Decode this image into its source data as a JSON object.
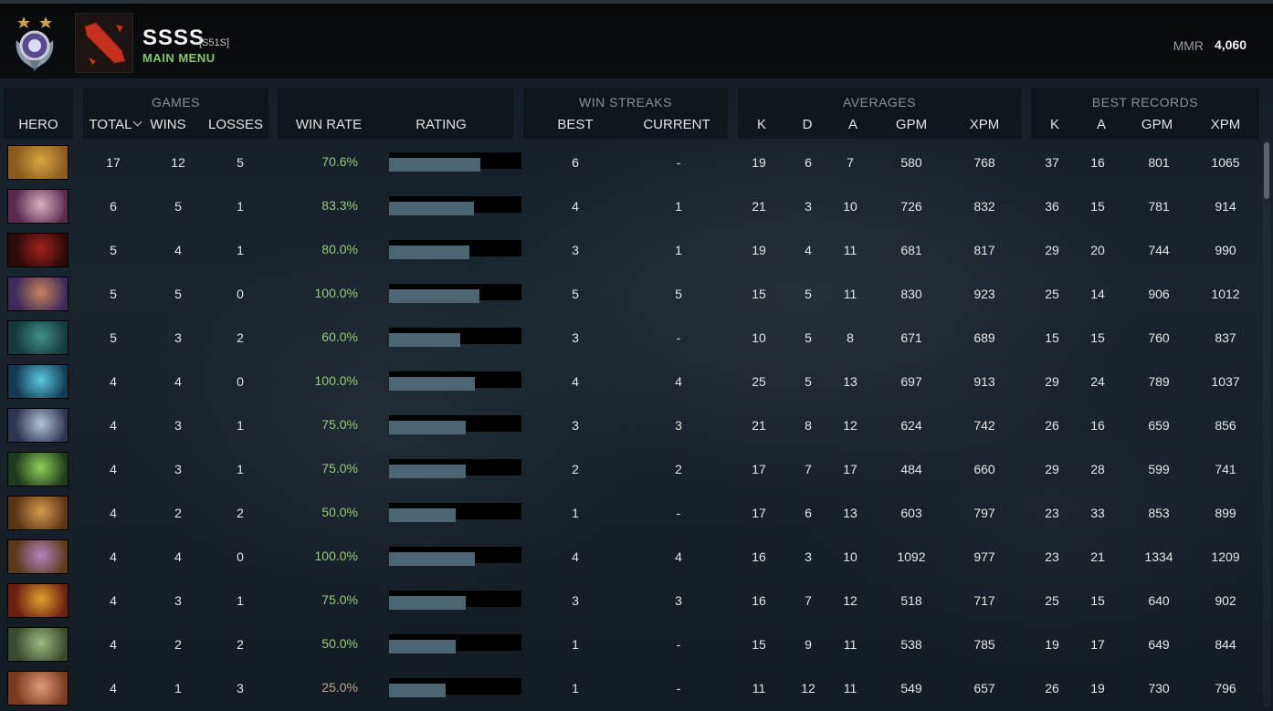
{
  "header": {
    "player_name": "SSSS",
    "player_tag": "[S51S]",
    "menu_label": "MAIN MENU",
    "mmr_label": "MMR",
    "mmr_value": "4,060"
  },
  "groups": {
    "games": "GAMES",
    "win_streaks": "WIN STREAKS",
    "averages": "AVERAGES",
    "best_records": "BEST RECORDS"
  },
  "columns": {
    "hero": "HERO",
    "total": "TOTAL",
    "wins": "WINS",
    "losses": "LOSSES",
    "win_rate": "WIN RATE",
    "rating": "RATING",
    "best": "BEST",
    "current": "CURRENT",
    "avg_k": "K",
    "avg_d": "D",
    "avg_a": "A",
    "avg_gpm": "GPM",
    "avg_xpm": "XPM",
    "best_k": "K",
    "best_a": "A",
    "best_gpm": "GPM",
    "best_xpm": "XPM"
  },
  "rows": [
    {
      "hero_icon": "monkey-king-portrait",
      "c1": "#8a5a1e",
      "c2": "#d8a440",
      "total": "17",
      "wins": "12",
      "losses": "5",
      "win_rate": "70.6%",
      "rating": 0.69,
      "best": "6",
      "current": "-",
      "k": "19",
      "d": "6",
      "a": "7",
      "gpm": "580",
      "xpm": "768",
      "bk": "37",
      "ba": "16",
      "bgpm": "801",
      "bxpm": "1065"
    },
    {
      "hero_icon": "invoker-portrait",
      "c1": "#5b2a4e",
      "c2": "#d9b1c0",
      "total": "6",
      "wins": "5",
      "losses": "1",
      "win_rate": "83.3%",
      "rating": 0.64,
      "best": "4",
      "current": "1",
      "k": "21",
      "d": "3",
      "a": "10",
      "gpm": "726",
      "xpm": "832",
      "bk": "36",
      "ba": "15",
      "bgpm": "781",
      "bxpm": "914"
    },
    {
      "hero_icon": "shadow-fiend-portrait",
      "c1": "#2a0a0a",
      "c2": "#a3221e",
      "total": "5",
      "wins": "4",
      "losses": "1",
      "win_rate": "80.0%",
      "rating": 0.61,
      "best": "3",
      "current": "1",
      "k": "19",
      "d": "4",
      "a": "11",
      "gpm": "681",
      "xpm": "817",
      "bk": "29",
      "ba": "20",
      "bgpm": "744",
      "bxpm": "990"
    },
    {
      "hero_icon": "anti-mage-portrait",
      "c1": "#3b2a5a",
      "c2": "#c8845a",
      "total": "5",
      "wins": "5",
      "losses": "0",
      "win_rate": "100.0%",
      "rating": 0.68,
      "best": "5",
      "current": "5",
      "k": "15",
      "d": "5",
      "a": "11",
      "gpm": "830",
      "xpm": "923",
      "bk": "25",
      "ba": "14",
      "bgpm": "906",
      "bxpm": "1012"
    },
    {
      "hero_icon": "templar-assassin-portrait",
      "c1": "#143a3a",
      "c2": "#3f8e88",
      "total": "5",
      "wins": "3",
      "losses": "2",
      "win_rate": "60.0%",
      "rating": 0.54,
      "best": "3",
      "current": "-",
      "k": "10",
      "d": "5",
      "a": "8",
      "gpm": "671",
      "xpm": "689",
      "bk": "15",
      "ba": "15",
      "bgpm": "760",
      "bxpm": "837"
    },
    {
      "hero_icon": "morphling-portrait",
      "c1": "#123a52",
      "c2": "#58c9de",
      "total": "4",
      "wins": "4",
      "losses": "0",
      "win_rate": "100.0%",
      "rating": 0.65,
      "best": "4",
      "current": "4",
      "k": "25",
      "d": "5",
      "a": "13",
      "gpm": "697",
      "xpm": "913",
      "bk": "29",
      "ba": "24",
      "bgpm": "789",
      "bxpm": "1037"
    },
    {
      "hero_icon": "mirana-portrait",
      "c1": "#2e3550",
      "c2": "#b7c2d8",
      "total": "4",
      "wins": "3",
      "losses": "1",
      "win_rate": "75.0%",
      "rating": 0.58,
      "best": "3",
      "current": "3",
      "k": "21",
      "d": "8",
      "a": "12",
      "gpm": "624",
      "xpm": "742",
      "bk": "26",
      "ba": "16",
      "bgpm": "659",
      "bxpm": "856"
    },
    {
      "hero_icon": "juggernaut-portrait",
      "c1": "#1e3a1c",
      "c2": "#8fd05a",
      "total": "4",
      "wins": "3",
      "losses": "1",
      "win_rate": "75.0%",
      "rating": 0.58,
      "best": "2",
      "current": "2",
      "k": "17",
      "d": "7",
      "a": "17",
      "gpm": "484",
      "xpm": "660",
      "bk": "29",
      "ba": "28",
      "bgpm": "599",
      "bxpm": "741"
    },
    {
      "hero_icon": "troll-warlord-portrait",
      "c1": "#5a3515",
      "c2": "#d59a4e",
      "total": "4",
      "wins": "2",
      "losses": "2",
      "win_rate": "50.0%",
      "rating": 0.5,
      "best": "1",
      "current": "-",
      "k": "17",
      "d": "6",
      "a": "13",
      "gpm": "603",
      "xpm": "797",
      "bk": "23",
      "ba": "33",
      "bgpm": "853",
      "bxpm": "899"
    },
    {
      "hero_icon": "alchemist-portrait",
      "c1": "#5a3a1a",
      "c2": "#b582c0",
      "total": "4",
      "wins": "4",
      "losses": "0",
      "win_rate": "100.0%",
      "rating": 0.65,
      "best": "4",
      "current": "4",
      "k": "16",
      "d": "3",
      "a": "10",
      "gpm": "1092",
      "xpm": "977",
      "bk": "23",
      "ba": "21",
      "bgpm": "1334",
      "bxpm": "1209"
    },
    {
      "hero_icon": "ember-spirit-portrait",
      "c1": "#6a2010",
      "c2": "#e0a030",
      "total": "4",
      "wins": "3",
      "losses": "1",
      "win_rate": "75.0%",
      "rating": 0.58,
      "best": "3",
      "current": "3",
      "k": "16",
      "d": "7",
      "a": "12",
      "gpm": "518",
      "xpm": "717",
      "bk": "25",
      "ba": "15",
      "bgpm": "640",
      "bxpm": "902"
    },
    {
      "hero_icon": "tiny-portrait",
      "c1": "#3a4a2e",
      "c2": "#9fb880",
      "total": "4",
      "wins": "2",
      "losses": "2",
      "win_rate": "50.0%",
      "rating": 0.5,
      "best": "1",
      "current": "-",
      "k": "15",
      "d": "9",
      "a": "11",
      "gpm": "538",
      "xpm": "785",
      "bk": "19",
      "ba": "17",
      "bgpm": "649",
      "bxpm": "844"
    },
    {
      "hero_icon": "bristleback-portrait",
      "c1": "#7a3a20",
      "c2": "#e09a7a",
      "total": "4",
      "wins": "1",
      "losses": "3",
      "win_rate": "25.0%",
      "rating": 0.43,
      "best": "1",
      "current": "-",
      "k": "11",
      "d": "12",
      "a": "11",
      "gpm": "549",
      "xpm": "657",
      "bk": "26",
      "ba": "19",
      "bgpm": "730",
      "bxpm": "796"
    }
  ],
  "colors": {
    "win_rate_text": "#98c884",
    "win_rate_low_text": "#c0a294",
    "rating_fill": "#4b6572",
    "menu_label": "#7fc96a"
  }
}
